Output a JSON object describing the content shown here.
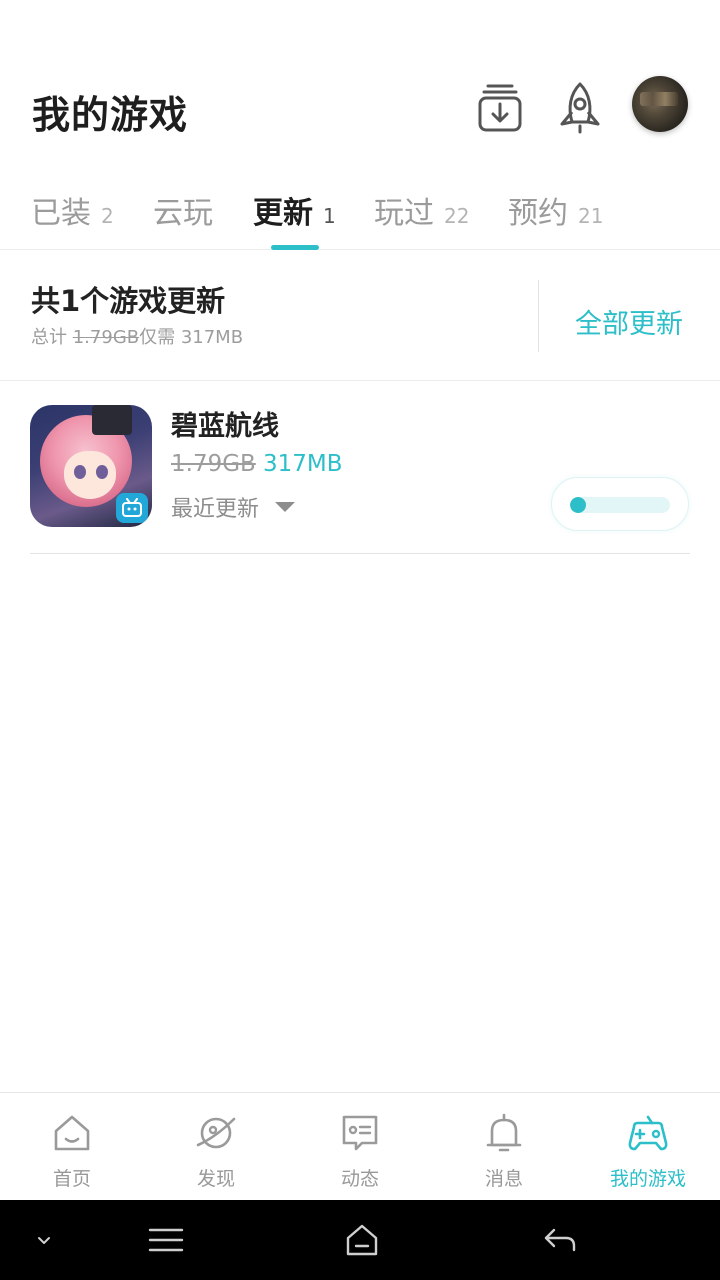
{
  "header": {
    "title": "我的游戏",
    "icons": [
      "download-icon",
      "rocket-icon",
      "avatar"
    ]
  },
  "tabs": [
    {
      "label": "已装",
      "count": "2",
      "active": false
    },
    {
      "label": "云玩",
      "count": "",
      "active": false
    },
    {
      "label": "更新",
      "count": "1",
      "active": true
    },
    {
      "label": "玩过",
      "count": "22",
      "active": false
    },
    {
      "label": "预约",
      "count": "21",
      "active": false
    }
  ],
  "summary": {
    "title": "共1个游戏更新",
    "sub_prefix": "总计",
    "sub_old_size": "1.79GB",
    "sub_suffix": "仅需  317MB",
    "update_all": "全部更新"
  },
  "game": {
    "name": "碧蓝航线",
    "old_size": "1.79GB",
    "new_size": "317MB",
    "recent_label": "最近更新",
    "progress": 0.05
  },
  "bottom_nav": [
    {
      "label": "首页",
      "icon": "home-icon",
      "active": false
    },
    {
      "label": "发现",
      "icon": "planet-icon",
      "active": false
    },
    {
      "label": "动态",
      "icon": "message-card-icon",
      "active": false
    },
    {
      "label": "消息",
      "icon": "bell-icon",
      "active": false
    },
    {
      "label": "我的游戏",
      "icon": "gamepad-icon",
      "active": true
    }
  ],
  "colors": {
    "accent": "#2dbfc9",
    "text_primary": "#222222",
    "text_secondary": "#9d9d9d"
  }
}
